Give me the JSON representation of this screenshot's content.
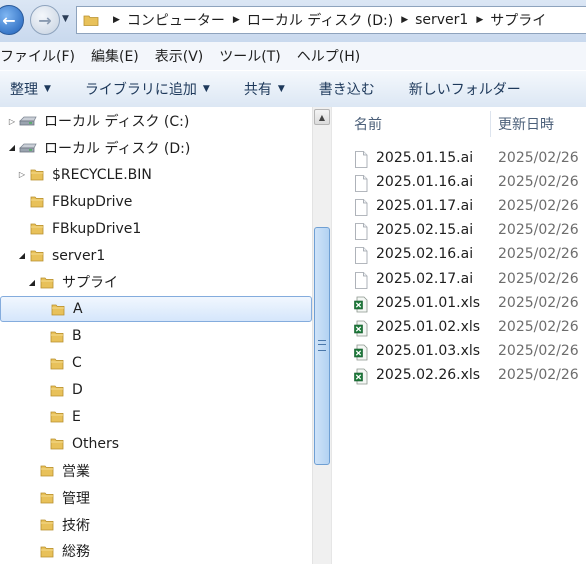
{
  "address": {
    "crumbs": [
      "コンピューター",
      "ローカル ディスク (D:)",
      "server1",
      "サプライ"
    ]
  },
  "menu": [
    "ファイル(F)",
    "編集(E)",
    "表示(V)",
    "ツール(T)",
    "ヘルプ(H)"
  ],
  "toolbar": {
    "organize": "整理",
    "add_to_library": "ライブラリに追加",
    "share": "共有",
    "burn": "書き込む",
    "new_folder": "新しいフォルダー"
  },
  "tree": [
    {
      "label": "ローカル ディスク (C:)",
      "kind": "drive",
      "expander": "collapsed"
    },
    {
      "label": "ローカル ディスク (D:)",
      "kind": "drive",
      "expander": "expanded"
    },
    {
      "label": "$RECYCLE.BIN",
      "kind": "folder",
      "expander": "collapsed"
    },
    {
      "label": "FBkupDrive",
      "kind": "folder",
      "expander": "none"
    },
    {
      "label": "FBkupDrive1",
      "kind": "folder",
      "expander": "none"
    },
    {
      "label": "server1",
      "kind": "folder",
      "expander": "expanded"
    },
    {
      "label": "サプライ",
      "kind": "folder",
      "expander": "expanded"
    },
    {
      "label": "A",
      "kind": "folder",
      "expander": "none",
      "selected": true
    },
    {
      "label": "B",
      "kind": "folder",
      "expander": "none"
    },
    {
      "label": "C",
      "kind": "folder",
      "expander": "none"
    },
    {
      "label": "D",
      "kind": "folder",
      "expander": "none"
    },
    {
      "label": "E",
      "kind": "folder",
      "expander": "none"
    },
    {
      "label": "Others",
      "kind": "folder",
      "expander": "none"
    },
    {
      "label": "営業",
      "kind": "folder",
      "expander": "none"
    },
    {
      "label": "管理",
      "kind": "folder",
      "expander": "none"
    },
    {
      "label": "技術",
      "kind": "folder",
      "expander": "none"
    },
    {
      "label": "総務",
      "kind": "folder",
      "expander": "none"
    }
  ],
  "columns": {
    "name": "名前",
    "modified": "更新日時"
  },
  "files": [
    {
      "name": "2025.01.15.ai",
      "date": "2025/02/26",
      "type": "generic-file-icon"
    },
    {
      "name": "2025.01.16.ai",
      "date": "2025/02/26",
      "type": "generic-file-icon"
    },
    {
      "name": "2025.01.17.ai",
      "date": "2025/02/26",
      "type": "generic-file-icon"
    },
    {
      "name": "2025.02.15.ai",
      "date": "2025/02/26",
      "type": "generic-file-icon"
    },
    {
      "name": "2025.02.16.ai",
      "date": "2025/02/26",
      "type": "generic-file-icon"
    },
    {
      "name": "2025.02.17.ai",
      "date": "2025/02/26",
      "type": "generic-file-icon"
    },
    {
      "name": "2025.01.01.xls",
      "date": "2025/02/26",
      "type": "excel-file-icon"
    },
    {
      "name": "2025.01.02.xls",
      "date": "2025/02/26",
      "type": "excel-file-icon"
    },
    {
      "name": "2025.01.03.xls",
      "date": "2025/02/26",
      "type": "excel-file-icon"
    },
    {
      "name": "2025.02.26.xls",
      "date": "2025/02/26",
      "type": "excel-file-icon"
    }
  ],
  "colors": {
    "selection": "#d5e6fb",
    "folder": "#e8c15a",
    "excel": "#1d7a3a"
  }
}
